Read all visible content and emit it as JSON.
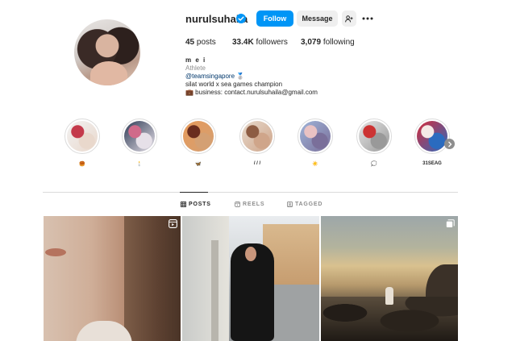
{
  "profile": {
    "username": "nurulsuhaila",
    "follow_label": "Follow",
    "message_label": "Message",
    "stats": {
      "posts_value": "45",
      "posts_label": "posts",
      "followers_value": "33.4K",
      "followers_label": "followers",
      "following_value": "3,079",
      "following_label": "following"
    },
    "bio": {
      "name": "m e i",
      "category": "Athlete",
      "tag": "@teamsingapore",
      "tag_emoji": "🥈",
      "line1": "silat world x sea games champion",
      "line2": "💼 business: contact.nurulsuhaila@gmail.com"
    }
  },
  "highlights": [
    {
      "label": "🥮",
      "colors": [
        "#f2f2f2",
        "#c43a4b",
        "#e9d8cc"
      ]
    },
    {
      "label": "🕯️",
      "colors": [
        "#2e3b55",
        "#d06a8a",
        "#e6e0e8"
      ]
    },
    {
      "label": "🦋",
      "colors": [
        "#e79a5a",
        "#6a2d1e",
        "#d4a073"
      ]
    },
    {
      "label": "/ / /",
      "colors": [
        "#e6d9cc",
        "#8d5c43",
        "#cfa58a"
      ]
    },
    {
      "label": "☀️",
      "colors": [
        "#9fb4d8",
        "#e9c2c3",
        "#7a6f9a"
      ]
    },
    {
      "label": "💭",
      "colors": [
        "#e5e5e5",
        "#c33",
        "#999"
      ]
    },
    {
      "label": "31SEAG",
      "colors": [
        "#d62b3a",
        "#f4e9e6",
        "#2a6bbf"
      ]
    }
  ],
  "tabs": [
    {
      "label": "POSTS",
      "icon": "grid-icon",
      "active": true
    },
    {
      "label": "REELS",
      "icon": "reels-icon",
      "active": false
    },
    {
      "label": "TAGGED",
      "icon": "tagged-icon",
      "active": false
    }
  ],
  "posts": [
    {
      "badge": "reel-icon"
    },
    {
      "badge": ""
    },
    {
      "badge": "carousel-icon"
    }
  ],
  "colors": {
    "accent": "#0095f6",
    "text": "#262626",
    "secondary": "#8e8e8e",
    "border": "#dbdbdb",
    "button_bg": "#efefef"
  }
}
